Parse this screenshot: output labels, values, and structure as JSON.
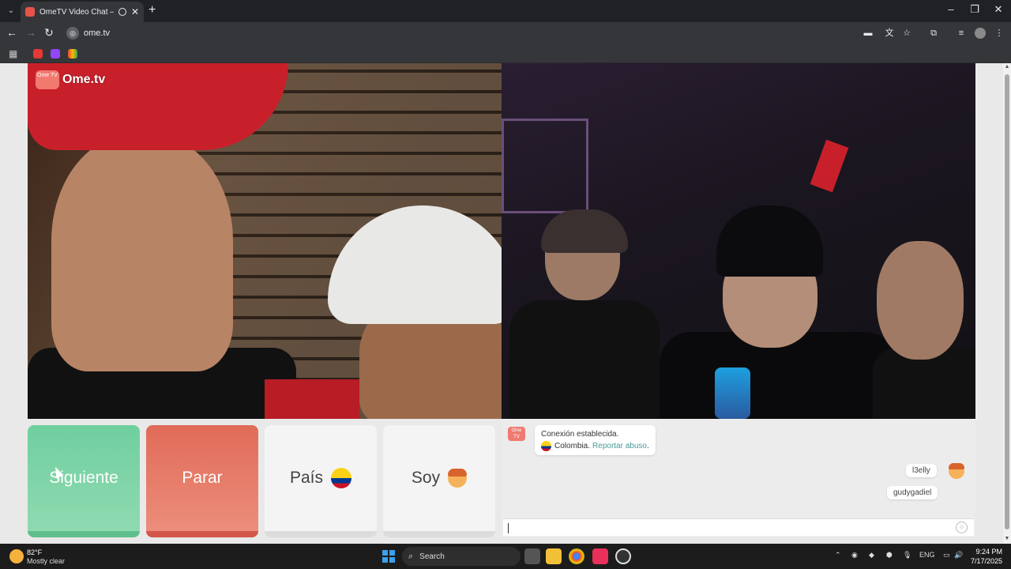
{
  "browser": {
    "tab_title": "OmeTV Video Chat — Ome",
    "tab_list_icon": "chevron-down-icon",
    "new_tab_icon": "+",
    "url": "ome.tv",
    "bookmarks": [
      "youtube",
      "twitch",
      "gmail"
    ]
  },
  "page": {
    "logo_text": "Ome.tv",
    "logo_badge": "Ome TV",
    "buttons": {
      "next": "Siguiente",
      "stop": "Parar",
      "country": "País",
      "gender": "Soy"
    },
    "chat": {
      "system_line_1": "Conexión establecida.",
      "country": "Colombia.",
      "report_link": "Reportar abuso",
      "report_suffix": ".",
      "messages": [
        "l3elly",
        "gudygadiel"
      ],
      "input_value": ""
    }
  },
  "taskbar": {
    "temperature": "82°F",
    "weather": "Mostly clear",
    "search_label": "Search",
    "language": "ENG",
    "time": "9:24 PM",
    "date": "7/17/2025"
  },
  "colors": {
    "next_button": "#6fcf9e",
    "stop_button": "#e06b58",
    "brand": "#f07a70"
  }
}
